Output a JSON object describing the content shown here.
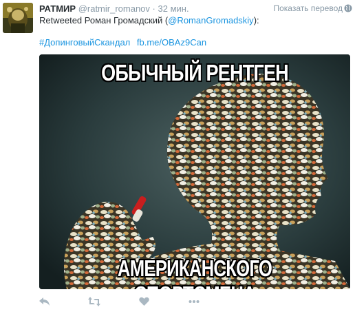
{
  "tweet": {
    "display_name": "РАТМИР",
    "handle": "@ratmir_romanov",
    "separator": "·",
    "time": "32 мин.",
    "translate_label": "Показать перевод",
    "retweet_text_prefix": "Retweeted Роман Громадский (",
    "retweet_mention": "@RomanGromadskiy",
    "retweet_text_suffix": "):",
    "hashtag": "#ДопинговыйСкандал",
    "link": "fb.me/OBAz9Can",
    "meme_top": "ОБЫЧНЫЙ РЕНТГЕН",
    "meme_bottom": "АМЕРИКАНСКОГО СПОРТСМЕНА"
  },
  "icons": {
    "reply": "reply-icon",
    "retweet": "retweet-icon",
    "like": "heart-icon",
    "more": "more-icon",
    "globe": "globe-icon"
  },
  "colors": {
    "link": "#1b95e0",
    "muted": "#8899a6",
    "text": "#292f33",
    "action_icon": "#aab8c2"
  }
}
